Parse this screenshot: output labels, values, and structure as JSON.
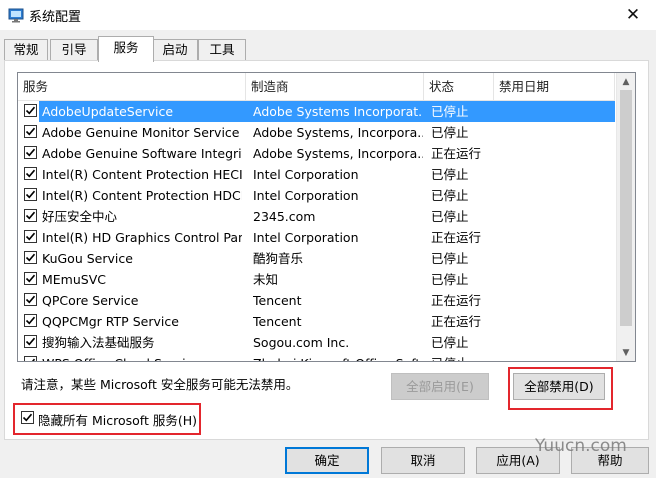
{
  "window": {
    "title": "系统配置",
    "close_glyph": "✕"
  },
  "tabs": [
    {
      "label": "常规",
      "active": false
    },
    {
      "label": "引导",
      "active": false
    },
    {
      "label": "服务",
      "active": true
    },
    {
      "label": "启动",
      "active": false
    },
    {
      "label": "工具",
      "active": false
    }
  ],
  "table": {
    "columns": [
      "服务",
      "制造商",
      "状态",
      "禁用日期"
    ],
    "rows": [
      {
        "checked": true,
        "service": "AdobeUpdateService",
        "maker": "Adobe Systems Incorporat...",
        "status": "已停止",
        "selected": true
      },
      {
        "checked": true,
        "service": "Adobe Genuine Monitor Service",
        "maker": "Adobe Systems, Incorpora...",
        "status": "已停止"
      },
      {
        "checked": true,
        "service": "Adobe Genuine Software Integrit...",
        "maker": "Adobe Systems, Incorpora...",
        "status": "正在运行"
      },
      {
        "checked": true,
        "service": "Intel(R) Content Protection HECI ...",
        "maker": "Intel Corporation",
        "status": "已停止"
      },
      {
        "checked": true,
        "service": "Intel(R) Content Protection HDCP...",
        "maker": "Intel Corporation",
        "status": "已停止"
      },
      {
        "checked": true,
        "service": "好压安全中心",
        "maker": "2345.com",
        "status": "已停止"
      },
      {
        "checked": true,
        "service": "Intel(R) HD Graphics Control Pan...",
        "maker": "Intel Corporation",
        "status": "正在运行"
      },
      {
        "checked": true,
        "service": "KuGou Service",
        "maker": "酷狗音乐",
        "status": "已停止"
      },
      {
        "checked": true,
        "service": "MEmuSVC",
        "maker": "未知",
        "status": "已停止"
      },
      {
        "checked": true,
        "service": "QPCore Service",
        "maker": "Tencent",
        "status": "正在运行"
      },
      {
        "checked": true,
        "service": "QQPCMgr RTP Service",
        "maker": "Tencent",
        "status": "正在运行"
      },
      {
        "checked": true,
        "service": "搜狗输入法基础服务",
        "maker": "Sogou.com Inc.",
        "status": "已停止"
      },
      {
        "checked": true,
        "service": "WPS Office Cloud Service",
        "maker": "Zhuhai Kingsoft Office Soft...",
        "status": "已停止"
      }
    ]
  },
  "note": "请注意，某些 Microsoft 安全服务可能无法禁用。",
  "buttons": {
    "enable_all": "全部启用(E)",
    "disable_all": "全部禁用(D)",
    "ok": "确定",
    "cancel": "取消",
    "apply": "应用(A)",
    "help": "帮助"
  },
  "hide_ms": {
    "checked": true,
    "label": "隐藏所有 Microsoft 服务(H)"
  },
  "watermark": "Yuucn.com",
  "colors": {
    "selection": "#3399ff",
    "highlight_box": "#e3262d",
    "default_button_border": "#0078d7"
  }
}
